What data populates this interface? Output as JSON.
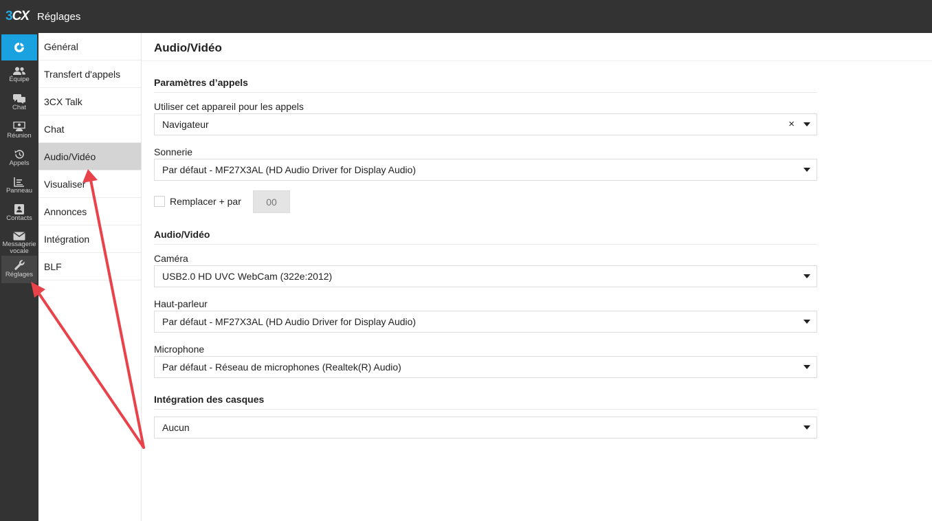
{
  "app": {
    "logo_3": "3",
    "logo_cx": "CX",
    "title": "Réglages"
  },
  "rail": {
    "items": [
      {
        "label": "Équipe",
        "icon": "team-icon"
      },
      {
        "label": "Chat",
        "icon": "chat-icon"
      },
      {
        "label": "Réunion",
        "icon": "meeting-icon"
      },
      {
        "label": "Appels",
        "icon": "history-icon"
      },
      {
        "label": "Panneau",
        "icon": "panel-icon"
      },
      {
        "label": "Contacts",
        "icon": "contacts-icon"
      },
      {
        "label": "Messagerie vocale",
        "icon": "voicemail-icon"
      },
      {
        "label": "Réglages",
        "icon": "wrench-icon"
      }
    ],
    "active": "Réglages"
  },
  "submenu": {
    "items": [
      {
        "label": "Général"
      },
      {
        "label": "Transfert d'appels"
      },
      {
        "label": "3CX Talk"
      },
      {
        "label": "Chat"
      },
      {
        "label": "Audio/Vidéo"
      },
      {
        "label": "Visualiser"
      },
      {
        "label": "Annonces"
      },
      {
        "label": "Intégration"
      },
      {
        "label": "BLF"
      }
    ],
    "active": "Audio/Vidéo"
  },
  "page": {
    "title": "Audio/Vidéo",
    "call_params": {
      "heading": "Paramètres d’appels",
      "device_label": "Utiliser cet appareil pour les appels",
      "device_value": "Navigateur",
      "clear_symbol": "×",
      "ringtone_label": "Sonnerie",
      "ringtone_value": "Par défaut - MF27X3AL (HD Audio Driver for Display Audio)",
      "replace_label": "Remplacer + par",
      "replace_checked": false,
      "replace_value": "00"
    },
    "av": {
      "heading": "Audio/Vidéo",
      "camera_label": "Caméra",
      "camera_value": "USB2.0 HD UVC WebCam (322e:2012)",
      "speaker_label": "Haut-parleur",
      "speaker_value": "Par défaut - MF27X3AL (HD Audio Driver for Display Audio)",
      "mic_label": "Microphone",
      "mic_value": "Par défaut - Réseau de microphones (Realtek(R) Audio)"
    },
    "headset": {
      "heading": "Intégration des casques",
      "value": "Aucun"
    }
  },
  "colors": {
    "topbar": "#333333",
    "accent": "#1aa1e0",
    "annotation_arrow": "#e8434a",
    "submenu_active": "#d4d4d4"
  }
}
